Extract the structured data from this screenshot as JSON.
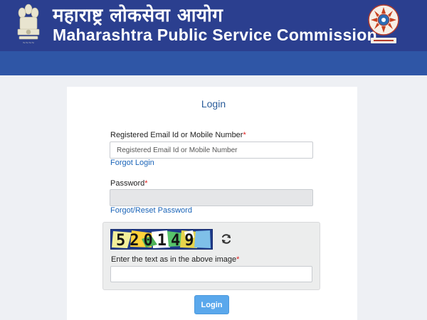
{
  "header": {
    "title_marathi": "महाराष्ट्र लोकसेवा आयोग",
    "title_english": "Maharashtra Public Service Commission",
    "emblem_icon": "state-emblem-icon",
    "seal_icon": "mpsc-seal-icon",
    "colors": {
      "banner": "#2b3f8f",
      "strip": "#2f56a6"
    }
  },
  "login_form": {
    "title": "Login",
    "username": {
      "label": "Registered Email Id or Mobile Number",
      "required_mark": "*",
      "placeholder": "Registered Email Id or Mobile Number",
      "value": ""
    },
    "forgot_login": "Forgot Login",
    "password": {
      "label": "Password",
      "required_mark": "*",
      "value": ""
    },
    "forgot_password": "Forgot/Reset Password",
    "captcha": {
      "image_text": "520149",
      "refresh_icon": "refresh-icon",
      "label": "Enter the text as in the above image",
      "required_mark": "*",
      "value": ""
    },
    "submit_label": "Login",
    "colors": {
      "link": "#1a64b8",
      "button": "#5aa8ec",
      "required": "#e02020"
    }
  }
}
